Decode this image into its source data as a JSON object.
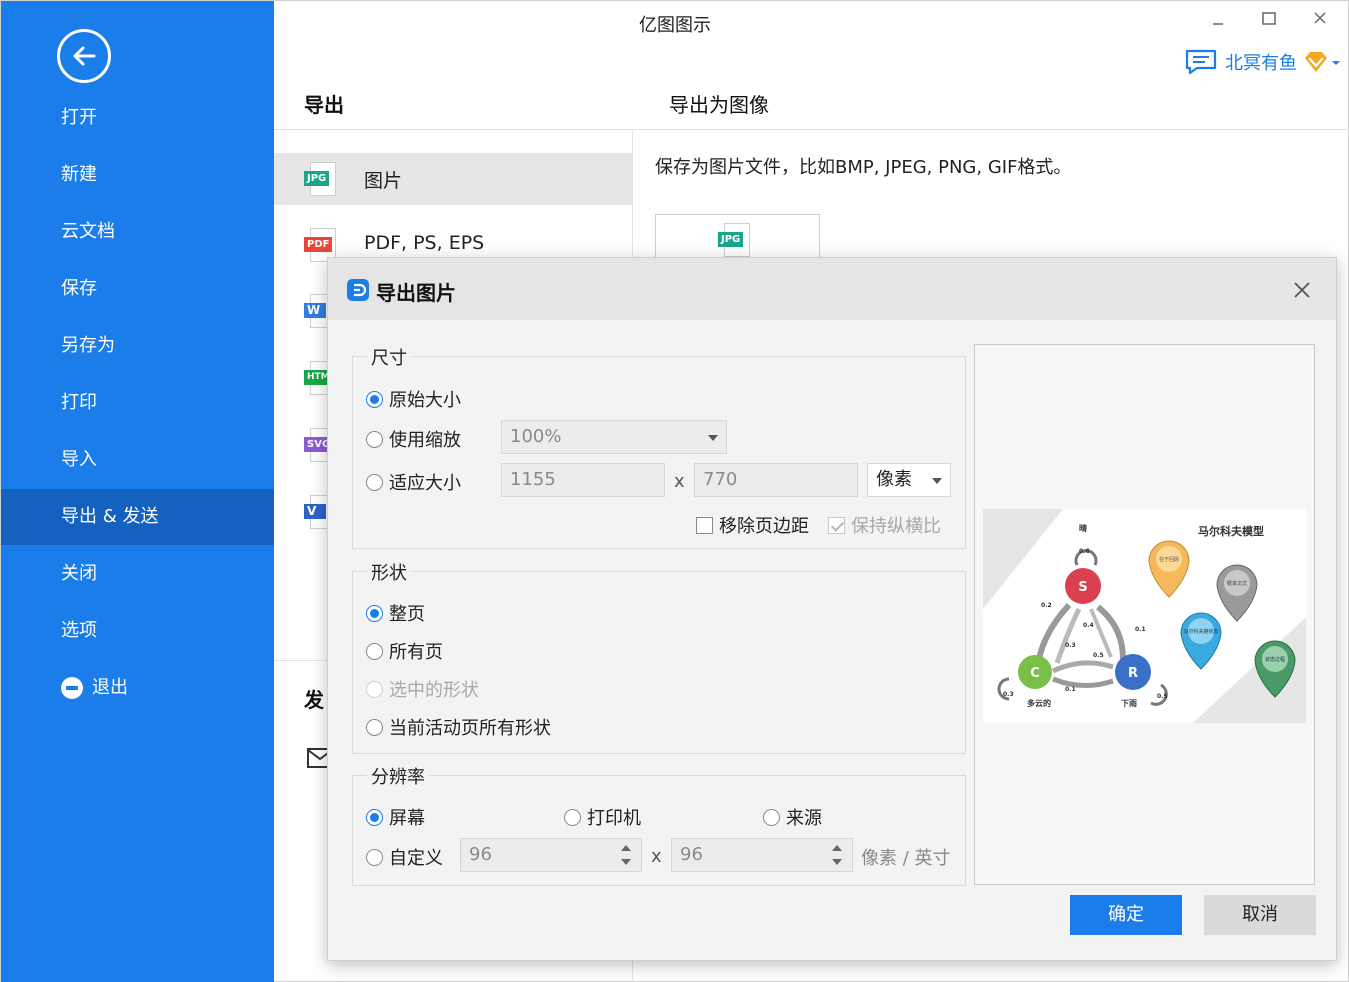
{
  "window": {
    "title": "亿图图示"
  },
  "user": {
    "name": "北冥有鱼"
  },
  "sidebar": {
    "items": [
      {
        "id": "open",
        "label": "打开"
      },
      {
        "id": "new",
        "label": "新建"
      },
      {
        "id": "cloud",
        "label": "云文档"
      },
      {
        "id": "save",
        "label": "保存"
      },
      {
        "id": "save-as",
        "label": "另存为"
      },
      {
        "id": "print",
        "label": "打印"
      },
      {
        "id": "import",
        "label": "导入"
      },
      {
        "id": "export-send",
        "label": "导出 & 发送",
        "active": true
      },
      {
        "id": "close",
        "label": "关闭"
      },
      {
        "id": "options",
        "label": "选项"
      },
      {
        "id": "exit",
        "label": "退出"
      }
    ]
  },
  "export_panel": {
    "header": "导出",
    "formats": [
      {
        "tag": "JPG",
        "label": "图片",
        "color": "#1aa68a"
      },
      {
        "tag": "PDF",
        "label": "PDF, PS, EPS",
        "color": "#e8453c"
      },
      {
        "tag": "W",
        "label": "",
        "color": "#2f7de1"
      },
      {
        "tag": "HTML",
        "label": "",
        "color": "#1aa64a"
      },
      {
        "tag": "SVG",
        "label": "",
        "color": "#8a5cd6"
      },
      {
        "tag": "V",
        "label": "",
        "color": "#2f62c8"
      }
    ],
    "send_header": "发"
  },
  "detail": {
    "header": "导出为图像",
    "description": "保存为图片文件，比如BMP, JPEG, PNG, GIF格式。",
    "thumb_tag": "JPG"
  },
  "dialog": {
    "title": "导出图片",
    "size": {
      "legend": "尺寸",
      "original_label": "原始大小",
      "scale_label": "使用缩放",
      "scale_value": "100%",
      "fit_label": "适应大小",
      "width": "1155",
      "height": "770",
      "times": "x",
      "unit": "像素",
      "remove_margin_label": "移除页边距",
      "keep_ratio_label": "保持纵横比"
    },
    "shape": {
      "legend": "形状",
      "whole_page": "整页",
      "all_pages": "所有页",
      "selected_shapes": "选中的形状",
      "active_page_shapes": "当前活动页所有形状"
    },
    "resolution": {
      "legend": "分辨率",
      "screen": "屏幕",
      "printer": "打印机",
      "source": "来源",
      "custom": "自定义",
      "dpi_x": "96",
      "dpi_y": "96",
      "times": "x",
      "unit": "像素 / 英寸"
    },
    "preview": {
      "title": "马尔科夫模型",
      "nodes": [
        {
          "letter": "S",
          "label": "晴",
          "color": "#d94050",
          "loop": "0.6"
        },
        {
          "letter": "C",
          "label": "多云的",
          "color": "#7ac048",
          "loop": "0.3"
        },
        {
          "letter": "R",
          "label": "下雨",
          "color": "#3a70c8",
          "loop": "0.5"
        }
      ],
      "edge_labels": [
        "0.2",
        "0.4",
        "0.1",
        "0.3",
        "0.5",
        "0.1"
      ],
      "pins": [
        {
          "label": "在于回顾",
          "color": "#f5b85a"
        },
        {
          "label": "概率文式",
          "color": "#9a9a9a"
        },
        {
          "label": "马尔科夫链状态",
          "color": "#3aaae0"
        },
        {
          "label": "状态过程",
          "color": "#4a9a68"
        }
      ]
    },
    "ok_label": "确定",
    "cancel_label": "取消"
  }
}
